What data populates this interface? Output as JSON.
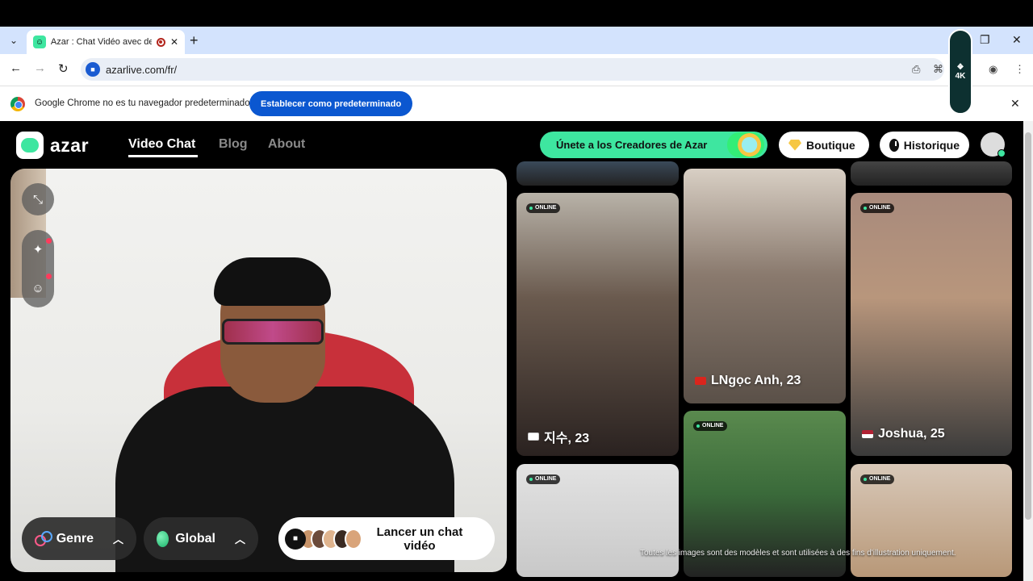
{
  "browser": {
    "tab_title": "Azar : Chat Vidéo avec de n",
    "url": "azarlive.com/fr/",
    "infobar_text": "Google Chrome no es tu navegador predeterminado",
    "infobar_button": "Establecer como predeterminado",
    "profile_badge": "4K"
  },
  "site": {
    "logo_text": "azar",
    "nav": [
      "Video Chat",
      "Blog",
      "About"
    ],
    "creators_button": "Únete a los Creadores de Azar",
    "boutique_button": "Boutique",
    "historique_button": "Historique"
  },
  "controls": {
    "genre_label": "Genre",
    "global_label": "Global",
    "launch_label": "Lancer un chat vidéo"
  },
  "profiles": [
    {
      "status": "ONLINE",
      "name": "지수, 23",
      "flag": "KR"
    },
    {
      "status": "",
      "name": "LNgọc Anh, 23",
      "flag": "VN"
    },
    {
      "status": "ONLINE",
      "name": "Joshua, 25",
      "flag": "US"
    },
    {
      "status": "ONLINE",
      "name": "",
      "flag": ""
    },
    {
      "status": "ONLINE",
      "name": "",
      "flag": ""
    },
    {
      "status": "ONLINE",
      "name": "",
      "flag": ""
    }
  ],
  "disclaimer": "Toutes les images sont des modèles et sont utilisées à des fins d'illustration uniquement.",
  "colors": {
    "accent_green": "#3ee6a0",
    "chrome_blue": "#0b57d0",
    "tabstrip": "#d3e3fd"
  }
}
